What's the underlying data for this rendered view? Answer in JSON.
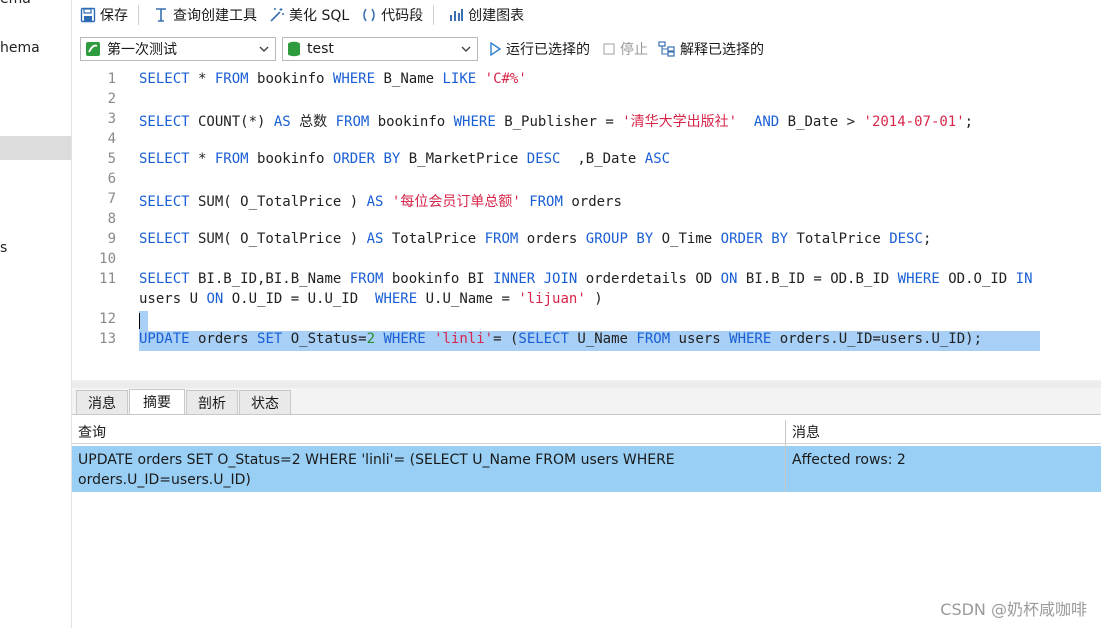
{
  "navigator": {
    "items": [
      "ema",
      "hema",
      "s"
    ]
  },
  "toolbar": {
    "save": "保存",
    "query_builder": "查询创建工具",
    "beautify_sql": "美化 SQL",
    "code_snippet": "代码段",
    "create_chart": "创建图表"
  },
  "selectors": {
    "connection": "第一次测试",
    "database": "test",
    "run_selected": "运行已选择的",
    "stop": "停止",
    "explain_selected": "解释已选择的"
  },
  "editor": {
    "line_numbers": [
      "1",
      "2",
      "3",
      "4",
      "5",
      "6",
      "7",
      "8",
      "9",
      "10",
      "11",
      "",
      "12",
      "13"
    ],
    "lines": [
      [
        {
          "t": "SELECT",
          "c": "kw"
        },
        {
          "t": " * "
        },
        {
          "t": "FROM",
          "c": "kw"
        },
        {
          "t": " bookinfo "
        },
        {
          "t": "WHERE",
          "c": "kw"
        },
        {
          "t": " B_Name "
        },
        {
          "t": "LIKE",
          "c": "kw"
        },
        {
          "t": " "
        },
        {
          "t": "'C#%'",
          "c": "str"
        }
      ],
      [],
      [
        {
          "t": "SELECT",
          "c": "kw"
        },
        {
          "t": " COUNT(*) "
        },
        {
          "t": "AS",
          "c": "kw"
        },
        {
          "t": " 总数 "
        },
        {
          "t": "FROM",
          "c": "kw"
        },
        {
          "t": " bookinfo "
        },
        {
          "t": "WHERE",
          "c": "kw"
        },
        {
          "t": " B_Publisher = "
        },
        {
          "t": "'清华大学出版社'",
          "c": "str"
        },
        {
          "t": "  "
        },
        {
          "t": "AND",
          "c": "kw"
        },
        {
          "t": " B_Date > "
        },
        {
          "t": "'2014-07-01'",
          "c": "str"
        },
        {
          "t": ";"
        }
      ],
      [],
      [
        {
          "t": "SELECT",
          "c": "kw"
        },
        {
          "t": " * "
        },
        {
          "t": "FROM",
          "c": "kw"
        },
        {
          "t": " bookinfo "
        },
        {
          "t": "ORDER BY",
          "c": "kw"
        },
        {
          "t": " B_MarketPrice "
        },
        {
          "t": "DESC",
          "c": "kw"
        },
        {
          "t": "  ,B_Date "
        },
        {
          "t": "ASC",
          "c": "kw"
        }
      ],
      [],
      [
        {
          "t": "SELECT",
          "c": "kw"
        },
        {
          "t": " SUM( O_TotalPrice ) "
        },
        {
          "t": "AS",
          "c": "kw"
        },
        {
          "t": " "
        },
        {
          "t": "'每位会员订单总额'",
          "c": "str"
        },
        {
          "t": " "
        },
        {
          "t": "FROM",
          "c": "kw"
        },
        {
          "t": " orders"
        }
      ],
      [],
      [
        {
          "t": "SELECT",
          "c": "kw"
        },
        {
          "t": " SUM( O_TotalPrice ) "
        },
        {
          "t": "AS",
          "c": "kw"
        },
        {
          "t": " TotalPrice "
        },
        {
          "t": "FROM",
          "c": "kw"
        },
        {
          "t": " orders "
        },
        {
          "t": "GROUP BY",
          "c": "kw"
        },
        {
          "t": " O_Time "
        },
        {
          "t": "ORDER BY",
          "c": "kw"
        },
        {
          "t": " TotalPrice "
        },
        {
          "t": "DESC",
          "c": "kw"
        },
        {
          "t": ";"
        }
      ],
      [],
      [
        {
          "t": "SELECT",
          "c": "kw"
        },
        {
          "t": " BI.B_ID,BI.B_Name "
        },
        {
          "t": "FROM",
          "c": "kw"
        },
        {
          "t": " bookinfo BI "
        },
        {
          "t": "INNER JOIN",
          "c": "kw"
        },
        {
          "t": " orderdetails OD "
        },
        {
          "t": "ON",
          "c": "kw"
        },
        {
          "t": " BI.B_ID = OD.B_ID "
        },
        {
          "t": "WHERE",
          "c": "kw"
        },
        {
          "t": " OD.O_ID "
        },
        {
          "t": "IN",
          "c": "kw"
        }
      ],
      [
        {
          "t": "users U "
        },
        {
          "t": "ON",
          "c": "kw"
        },
        {
          "t": " O.U_ID = U.U_ID  "
        },
        {
          "t": "WHERE",
          "c": "kw"
        },
        {
          "t": " U.U_Name = "
        },
        {
          "t": "'lijuan'",
          "c": "str"
        },
        {
          "t": " )"
        }
      ],
      [],
      [
        {
          "t": "UPDATE",
          "c": "kw"
        },
        {
          "t": " orders "
        },
        {
          "t": "SET",
          "c": "kw"
        },
        {
          "t": " O_Status="
        },
        {
          "t": "2",
          "c": "num"
        },
        {
          "t": " "
        },
        {
          "t": "WHERE",
          "c": "kw"
        },
        {
          "t": " "
        },
        {
          "t": "'linli'",
          "c": "str"
        },
        {
          "t": "= ("
        },
        {
          "t": "SELECT",
          "c": "kw"
        },
        {
          "t": " U_Name "
        },
        {
          "t": "FROM",
          "c": "kw"
        },
        {
          "t": " users "
        },
        {
          "t": "WHERE",
          "c": "kw"
        },
        {
          "t": " orders.U_ID=users.U_ID);"
        }
      ]
    ]
  },
  "result_tabs": [
    "消息",
    "摘要",
    "剖析",
    "状态"
  ],
  "summary": {
    "col_query": "查询",
    "col_message": "消息",
    "row_query_line1": "UPDATE orders SET O_Status=2 WHERE 'linli'= (SELECT U_Name FROM users WHERE",
    "row_query_line2": "orders.U_ID=users.U_ID)",
    "row_message": "Affected rows: 2"
  },
  "watermark": "CSDN @奶杯咸咖啡",
  "colors": {
    "keyword": "#1a5fd6",
    "string": "#d8264a",
    "number": "#2a8a2a",
    "selection": "#a8cff5",
    "row_highlight": "#99cff5"
  }
}
